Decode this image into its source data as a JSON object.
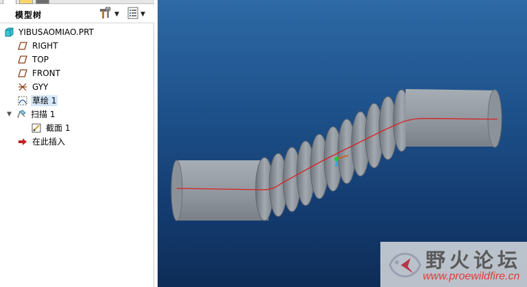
{
  "model_tree": {
    "title": "模型树",
    "tools_icon": "hammer-wrench-icon",
    "settings_icon": "list-settings-icon",
    "items": [
      {
        "label": "YIBUSAOMIAO.PRT",
        "icon": "part-icon"
      },
      {
        "label": "RIGHT",
        "icon": "datum-plane-icon"
      },
      {
        "label": "TOP",
        "icon": "datum-plane-icon"
      },
      {
        "label": "FRONT",
        "icon": "datum-plane-icon"
      },
      {
        "label": "GYY",
        "icon": "coordinate-system-icon"
      },
      {
        "label": "草绘 1",
        "icon": "sketch-icon",
        "selected": true
      },
      {
        "label": "扫描 1",
        "icon": "sweep-icon",
        "expanded": true
      },
      {
        "label": "截面 1",
        "icon": "section-icon"
      },
      {
        "label": "在此插入",
        "icon": "insert-here-arrow-icon"
      }
    ]
  },
  "viewport": {
    "model": "bellows-sweep-part",
    "trajectory_color": "#e02020",
    "model_color": "#8f959c"
  },
  "watermark": {
    "title": "野火论坛",
    "url": "www.proewildfire.cn",
    "logo": "fish-logo-icon"
  }
}
